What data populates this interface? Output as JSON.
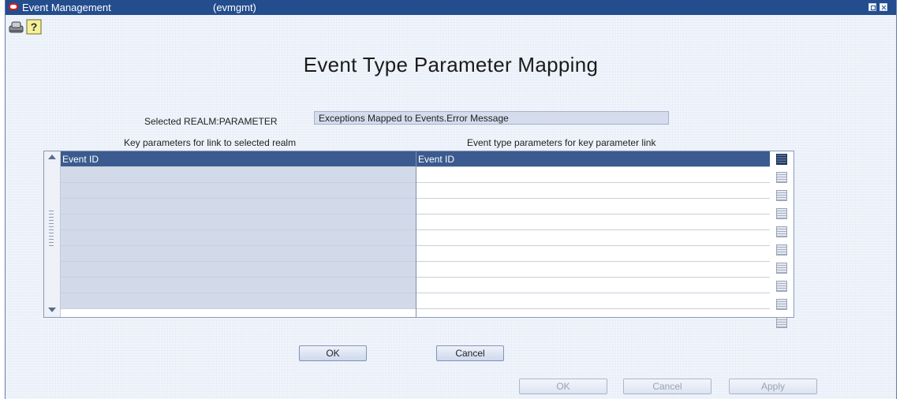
{
  "window": {
    "title": "Event Management",
    "subtitle": "(evmgmt)"
  },
  "toolbar": {
    "icons": [
      "stamp-icon",
      "help-icon"
    ]
  },
  "page": {
    "title": "Event Type Parameter Mapping"
  },
  "realm": {
    "label": "Selected REALM:PARAMETER",
    "value": "Exceptions Mapped to Events.Error Message"
  },
  "grid": {
    "left_header": "Key parameters for link to selected realm",
    "right_header": "Event type parameters for key parameter link",
    "rows": [
      {
        "key": "Event ID",
        "event": "Event ID"
      },
      {
        "key": "",
        "event": ""
      },
      {
        "key": "",
        "event": ""
      },
      {
        "key": "",
        "event": ""
      },
      {
        "key": "",
        "event": ""
      },
      {
        "key": "",
        "event": ""
      },
      {
        "key": "",
        "event": ""
      },
      {
        "key": "",
        "event": ""
      },
      {
        "key": "",
        "event": ""
      },
      {
        "key": "",
        "event": ""
      }
    ]
  },
  "dialog_buttons": {
    "ok": "OK",
    "cancel": "Cancel"
  },
  "footer_buttons": {
    "ok": "OK",
    "cancel": "Cancel",
    "apply": "Apply"
  },
  "colors": {
    "titlebar": "#244d8e",
    "active_row": "#3b5a8f",
    "key_cell": "#d2daea"
  }
}
